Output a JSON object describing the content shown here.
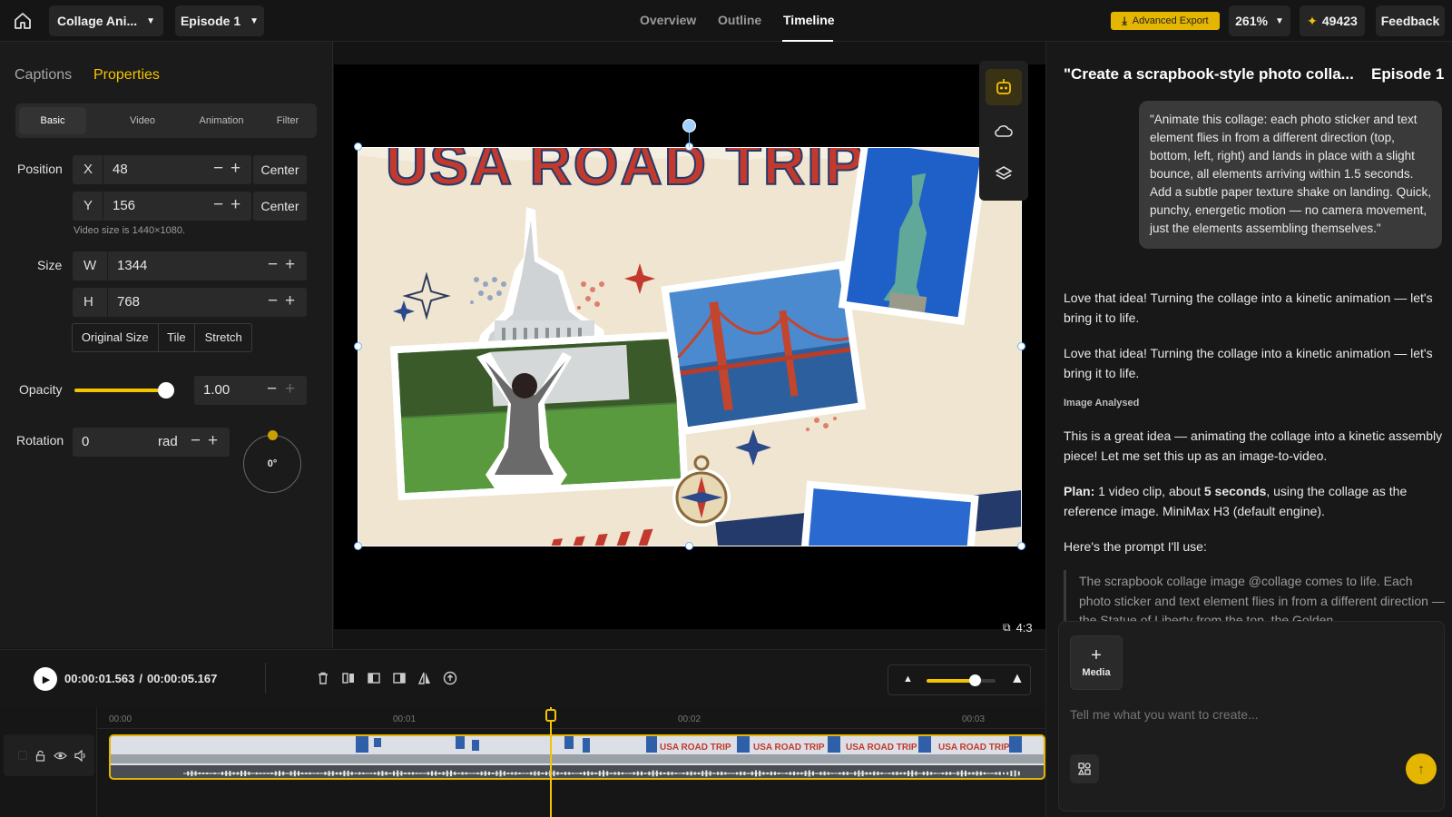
{
  "topbar": {
    "project_title": "Collage Ani...",
    "episode": "Episode 1",
    "nav": [
      "Overview",
      "Outline",
      "Timeline"
    ],
    "active_nav": "Timeline",
    "export_label": "Advanced Export",
    "zoom": "261%",
    "credits": "49423",
    "feedback": "Feedback",
    "accent_color": "#f5c400"
  },
  "left": {
    "tabs": [
      "Captions",
      "Properties"
    ],
    "active_tab": "Properties",
    "subtabs": [
      "Basic",
      "Video",
      "Animation",
      "Filter"
    ],
    "position_label": "Position",
    "x_label": "X",
    "x_value": "48",
    "y_label": "Y",
    "y_value": "156",
    "center_label": "Center",
    "video_size_note": "Video size is 1440×1080.",
    "size_label": "Size",
    "w_label": "W",
    "w_value": "1344",
    "h_label": "H",
    "h_value": "768",
    "size_buttons": [
      "Original Size",
      "Tile",
      "Stretch"
    ],
    "opacity_label": "Opacity",
    "opacity_value": "1.00",
    "opacity_level": 1.0,
    "rotation_label": "Rotation",
    "rotation_value": "0",
    "rotation_unit": "rad",
    "rotation_dial": "0°",
    "minus": "−",
    "plus": "+"
  },
  "preview": {
    "collage_title": "USA ROAD TRIP",
    "aspect": "4:3"
  },
  "playback": {
    "current": "00:00:01.563",
    "separator": "/",
    "total": "00:00:05.167",
    "zoom_level": 0.7
  },
  "timeline": {
    "ticks": [
      "00:00",
      "00:01",
      "00:02",
      "00:03"
    ],
    "clip_caption": "USA ROAD TRIP"
  },
  "chat": {
    "title": "\"Create a scrapbook-style photo colla...",
    "episode": "Episode 1",
    "user_prompt": "\"Animate this collage: each photo sticker and text element flies in from a different direction (top, bottom, left, right) and lands in place with a slight bounce, all elements arriving within 1.5 seconds. Add a subtle paper texture shake on landing. Quick, punchy, energetic motion — no camera movement, just the elements assembling themselves.\"",
    "reply_1": "Love that idea! Turning the collage into a kinetic animation — let's bring it to life.",
    "reply_2": "Love that idea! Turning the collage into a kinetic animation — let's bring it to life.",
    "image_analysed": "Image Analysed",
    "reply_3": "This is a great idea — animating the collage into a kinetic assembly piece! Let me set this up as an image-to-video.",
    "plan_label": "Plan:",
    "plan_text_1": " 1 video clip, about ",
    "plan_bold": "5 seconds",
    "plan_text_2": ", using the collage as the reference image. MiniMax H3 (default engine).",
    "prompt_intro": "Here's the prompt I'll use:",
    "quote": "The scrapbook collage image @collage comes to life. Each photo sticker and text element flies in from a different direction — the Statue of Liberty from the top, the Golden",
    "media_label": "Media",
    "input_placeholder": "Tell me what you want to create..."
  }
}
